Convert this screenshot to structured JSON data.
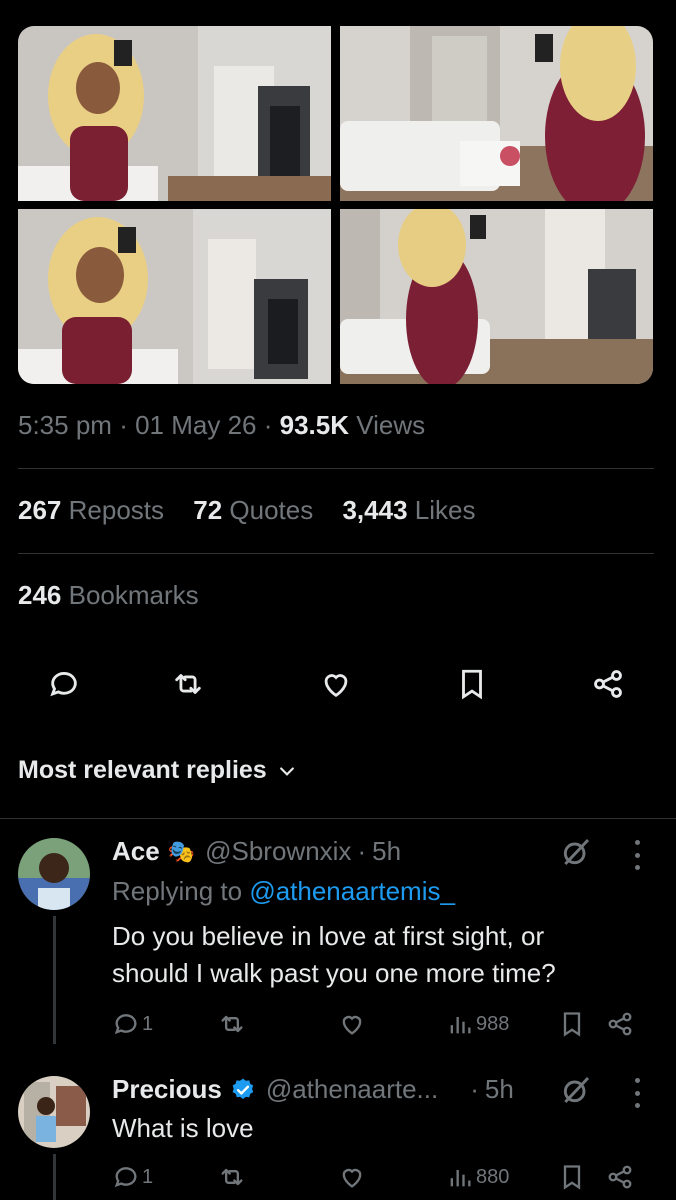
{
  "post": {
    "time": "5:35 pm",
    "date": "01 May 26",
    "views_count": "93.5K",
    "views_label": "Views",
    "sep": "·"
  },
  "engagement": {
    "reposts_count": "267",
    "reposts_label": "Reposts",
    "quotes_count": "72",
    "quotes_label": "Quotes",
    "likes_count": "3,443",
    "likes_label": "Likes",
    "bookmarks_count": "246",
    "bookmarks_label": "Bookmarks"
  },
  "actions": [
    "reply-icon",
    "repost-icon",
    "like-icon",
    "bookmark-icon",
    "share-icon"
  ],
  "replies_sort_label": "Most relevant replies",
  "replies": [
    {
      "name": "Ace",
      "emoji": "🎭",
      "handle": "@Sbrownxix",
      "sep": "·",
      "time": "5h",
      "replying_prefix": "Replying to",
      "replying_to": "@athenaartemis_",
      "text_line1": "Do you believe in love at first sight, or",
      "text_line2": "should I walk past you one more time?",
      "reply_count": "1",
      "views": "988"
    },
    {
      "name": "Precious",
      "verified": true,
      "handle": "@athenaarte...",
      "sep": "·",
      "time": "5h",
      "text": "What is love",
      "reply_count": "1",
      "views": "880"
    }
  ],
  "colors": {
    "background": "#000000",
    "text_primary": "#e7e9ea",
    "text_secondary": "#71767b",
    "link": "#1d9bf0",
    "divider": "#2f3336",
    "verified": "#1d9bf0"
  }
}
